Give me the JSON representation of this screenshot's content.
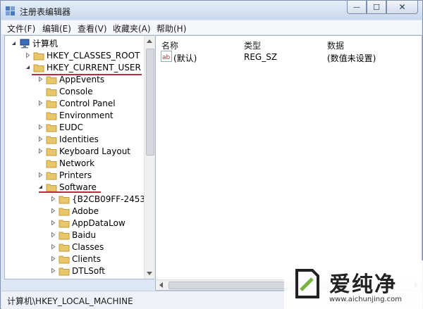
{
  "window": {
    "title": "注册表编辑器",
    "buttons": {
      "minimize": "—",
      "maximize": "☐",
      "close": "✕"
    }
  },
  "menu": [
    "文件(F)",
    "编辑(E)",
    "查看(V)",
    "收藏夹(A)",
    "帮助(H)"
  ],
  "tree": {
    "root": "计算机",
    "hives": {
      "classes_root": "HKEY_CLASSES_ROOT",
      "current_user": "HKEY_CURRENT_USER"
    },
    "current_user_children": [
      "AppEvents",
      "Console",
      "Control Panel",
      "Environment",
      "EUDC",
      "Identities",
      "Keyboard Layout",
      "Network",
      "Printers",
      "Software"
    ],
    "software_children": [
      "{B2CB09FF-2453-",
      "Adobe",
      "AppDataLow",
      "Baidu",
      "Classes",
      "Clients",
      "DTLSoft"
    ]
  },
  "list": {
    "columns": [
      "名称",
      "类型",
      "数据"
    ],
    "rows": [
      {
        "name": "(默认)",
        "type": "REG_SZ",
        "data": "(数值未设置)",
        "icon": "string-value-icon"
      }
    ]
  },
  "status": "计算机\\HKEY_LOCAL_MACHINE",
  "watermark": {
    "text": "爱纯净",
    "url": "www.aichunjing.com"
  },
  "colors": {
    "underline": "#c0283c",
    "folder": "#e8c66a"
  }
}
